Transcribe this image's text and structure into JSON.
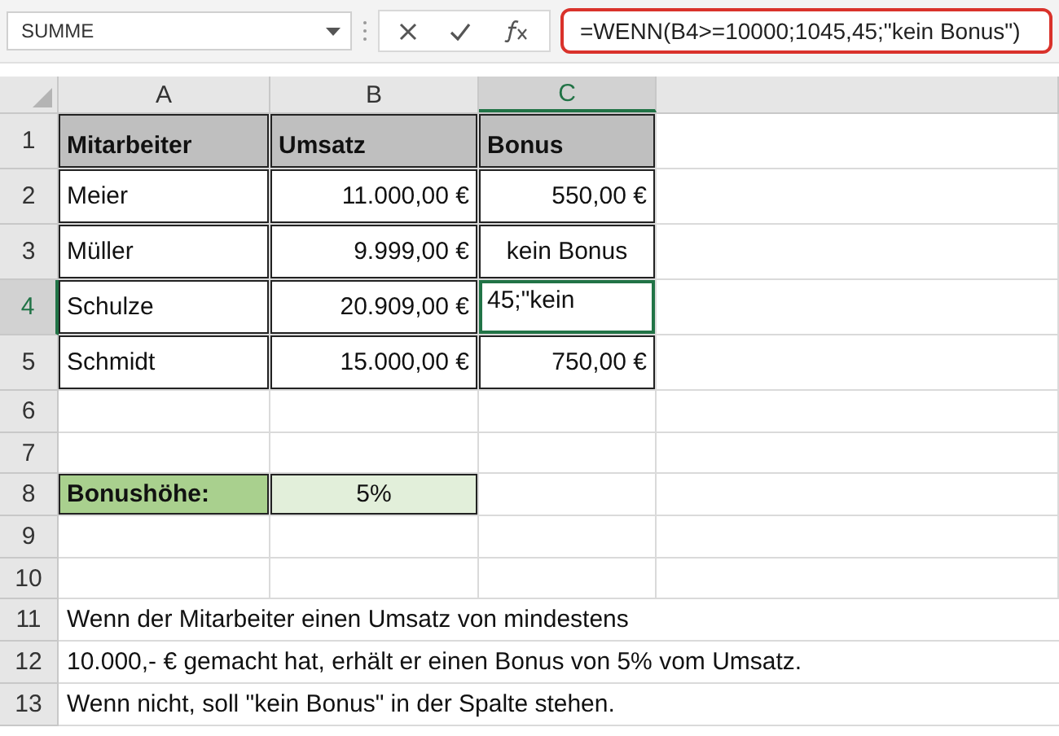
{
  "name_box": {
    "value": "SUMME"
  },
  "formula_bar": {
    "value": "=WENN(B4>=10000;1045,45;\"kein Bonus\")",
    "highlighted": true
  },
  "columns": [
    {
      "label": "A",
      "selected": false
    },
    {
      "label": "B",
      "selected": false
    },
    {
      "label": "C",
      "selected": true
    }
  ],
  "rows": [
    {
      "number": "1",
      "selected": false,
      "cells": [
        {
          "text": "Mitarbeiter",
          "kind": "header"
        },
        {
          "text": "Umsatz",
          "kind": "header"
        },
        {
          "text": "Bonus",
          "kind": "header"
        }
      ]
    },
    {
      "number": "2",
      "selected": false,
      "cells": [
        {
          "text": "Meier",
          "kind": "text"
        },
        {
          "text": "11.000,00 €",
          "kind": "number"
        },
        {
          "text": "550,00 €",
          "kind": "number"
        }
      ]
    },
    {
      "number": "3",
      "selected": false,
      "cells": [
        {
          "text": "Müller",
          "kind": "text"
        },
        {
          "text": "9.999,00 €",
          "kind": "number"
        },
        {
          "text": "kein Bonus",
          "kind": "center"
        }
      ]
    },
    {
      "number": "4",
      "selected": true,
      "cells": [
        {
          "text": "Schulze",
          "kind": "text"
        },
        {
          "text": "20.909,00 €",
          "kind": "number"
        },
        {
          "text": "45;\"kein",
          "kind": "editing"
        }
      ]
    },
    {
      "number": "5",
      "selected": false,
      "cells": [
        {
          "text": "Schmidt",
          "kind": "text"
        },
        {
          "text": "15.000,00 €",
          "kind": "number"
        },
        {
          "text": "750,00 €",
          "kind": "number"
        }
      ]
    },
    {
      "number": "6",
      "selected": false
    },
    {
      "number": "7",
      "selected": false
    },
    {
      "number": "8",
      "selected": false,
      "cells": [
        {
          "text": "Bonushöhe:",
          "kind": "label"
        },
        {
          "text": "5%",
          "kind": "rate"
        }
      ]
    },
    {
      "number": "9",
      "selected": false
    },
    {
      "number": "10",
      "selected": false
    },
    {
      "number": "11",
      "selected": false,
      "cells": [
        {
          "text": "Wenn der Mitarbeiter einen Umsatz von mindestens",
          "kind": "note"
        }
      ]
    },
    {
      "number": "12",
      "selected": false,
      "cells": [
        {
          "text": "10.000,- € gemacht hat, erhält er einen Bonus von 5% vom Umsatz.",
          "kind": "note"
        }
      ]
    },
    {
      "number": "13",
      "selected": false,
      "cells": [
        {
          "text": "Wenn nicht, soll \"kein Bonus\" in der Spalte stehen.",
          "kind": "note"
        }
      ]
    }
  ]
}
